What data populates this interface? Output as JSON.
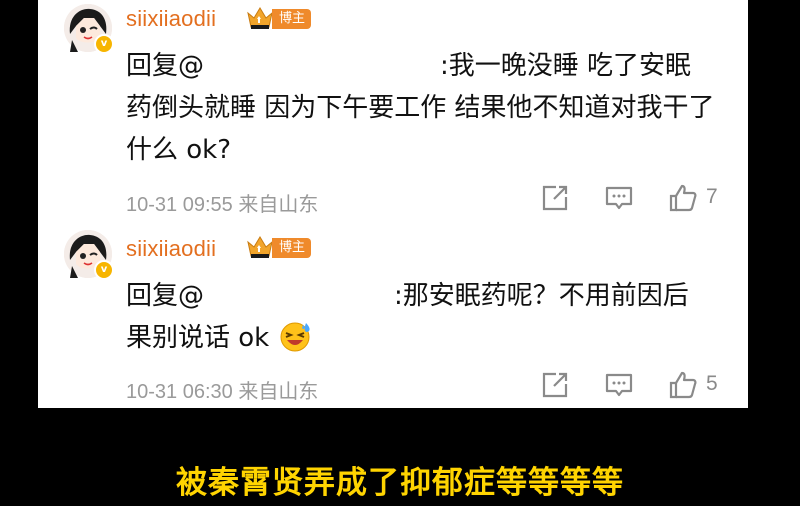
{
  "comments": [
    {
      "username": "siixiiaodii",
      "badge": "博主",
      "reply_prefix": "回复@",
      "text_line1": ":我一晚没睡 吃了安眠",
      "text_rest": "药倒头就睡 因为下午要工作 结果他不知道对我干了什么 ok?",
      "date": "10-31 09:55",
      "location": "来自山东",
      "likes": "7"
    },
    {
      "username": "siixiiaodii",
      "badge": "博主",
      "reply_prefix": "回复@",
      "text_line1": ":那安眠药呢？不用前因后",
      "text_rest": "果别说话 ok",
      "emoji": "laughing-crying-emoji",
      "date": "10-31 06:30",
      "location": "来自山东",
      "likes": "5"
    }
  ],
  "caption": "被秦霄贤弄成了抑郁症等等等等",
  "colors": {
    "username": "#e36f1f",
    "badge_bg": "#ef8a2b",
    "caption": "#ffd400",
    "meta": "#9a9a9a"
  },
  "icons": [
    "share-icon",
    "comment-icon",
    "like-icon",
    "crown-icon",
    "verified-icon"
  ]
}
